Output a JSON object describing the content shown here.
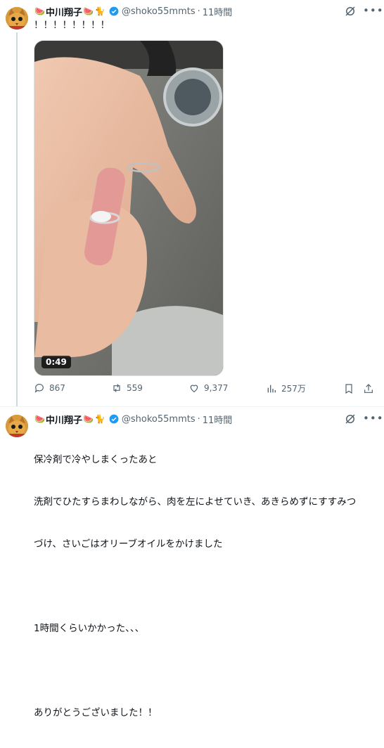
{
  "tweets": [
    {
      "name": "中川翔子",
      "handle": "@shoko55mmts",
      "time": "11時間",
      "text": "！！！！！！！！",
      "video_duration": "0:49",
      "stats": {
        "replies": "867",
        "retweets": "559",
        "likes": "9,377",
        "views": "257万"
      }
    },
    {
      "name": "中川翔子",
      "handle": "@shoko55mmts",
      "time": "11時間",
      "text_lines": [
        "保冷剤で冷やしまくったあと",
        "洗剤でひたすらまわしながら、肉を左によせていき、あきらめずにすすみつ",
        "づけ、さいごはオリーブオイルをかけました",
        "",
        "1時間くらいかかった、、、",
        "",
        "ありがとうございました！！"
      ]
    }
  ],
  "colors": {
    "accent": "#1d9bf0",
    "muted": "#536471",
    "verified": "#1d9bf0"
  },
  "icons": {
    "reply": "reply-icon",
    "retweet": "retweet-icon",
    "like": "heart-icon",
    "views": "views-icon",
    "bookmark": "bookmark-icon",
    "share": "share-icon",
    "grok": "grok-icon",
    "more": "more-icon"
  }
}
